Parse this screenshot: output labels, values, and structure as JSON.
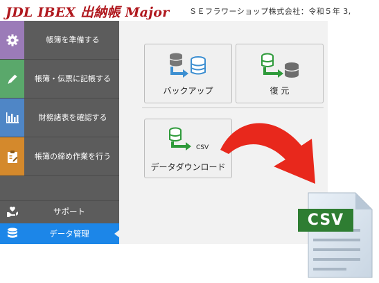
{
  "header": {
    "logo": "JDL IBEX 出納帳 Major",
    "company": "ＳＥフラワーショップ株式会社：令和５年 3,"
  },
  "sidebar": {
    "items": [
      {
        "label": "帳簿を準備する",
        "icon": "gear-icon",
        "color": "#9b7bb8"
      },
      {
        "label": "帳簿・伝票に記帳する",
        "icon": "pencil-icon",
        "color": "#5aa86b"
      },
      {
        "label": "財務諸表を確認する",
        "icon": "bar-chart-icon",
        "color": "#4f86c6"
      },
      {
        "label": "帳簿の締め作業を行う",
        "icon": "clipboard-icon",
        "color": "#d4892c"
      }
    ],
    "support": {
      "label": "サポート",
      "icon": "hand-heart-icon"
    },
    "data_management": {
      "label": "データ管理",
      "icon": "database-icon",
      "color": "#1c86e8"
    }
  },
  "main": {
    "tiles": [
      {
        "label": "バックアップ",
        "icon": "backup-icon"
      },
      {
        "label": "復 元",
        "icon": "restore-icon"
      },
      {
        "label": "データダウンロード",
        "icon": "csv-download-icon",
        "badge": "CSV"
      }
    ]
  },
  "document": {
    "badge": "CSV",
    "icon": "csv-file-icon",
    "color": "#2e7d32"
  },
  "colors": {
    "accent": "#b0181e",
    "arrow": "#e8281c",
    "green": "#2e9a3a",
    "blue": "#3d8fd1"
  }
}
